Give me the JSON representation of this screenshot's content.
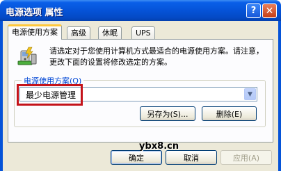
{
  "window": {
    "title": "电源选项 属性"
  },
  "titlebar": {
    "help_label": "?",
    "close_label": "✕"
  },
  "tabs": [
    {
      "label": "电源使用方案",
      "active": true
    },
    {
      "label": "高级",
      "active": false
    },
    {
      "label": "休眠",
      "active": false
    },
    {
      "label": "UPS",
      "active": false
    }
  ],
  "panel": {
    "description": "请选定对于您使用计算机方式最适合的电源使用方案。请注意，更改下面的设置将修改选定的方案。",
    "group_label": "电源使用方案(Q)",
    "scheme_select": {
      "value": "最少电源管理"
    },
    "save_as_label": "另存为(S)...",
    "delete_label": "删除(E)"
  },
  "footer": {
    "ok_label": "确定",
    "cancel_label": "取消",
    "apply_label": "应用(A)"
  },
  "watermark": "ybx8.cn",
  "colors": {
    "title_bar": "#0553d8",
    "highlight_border": "#c4131a",
    "group_label": "#0046d5"
  }
}
